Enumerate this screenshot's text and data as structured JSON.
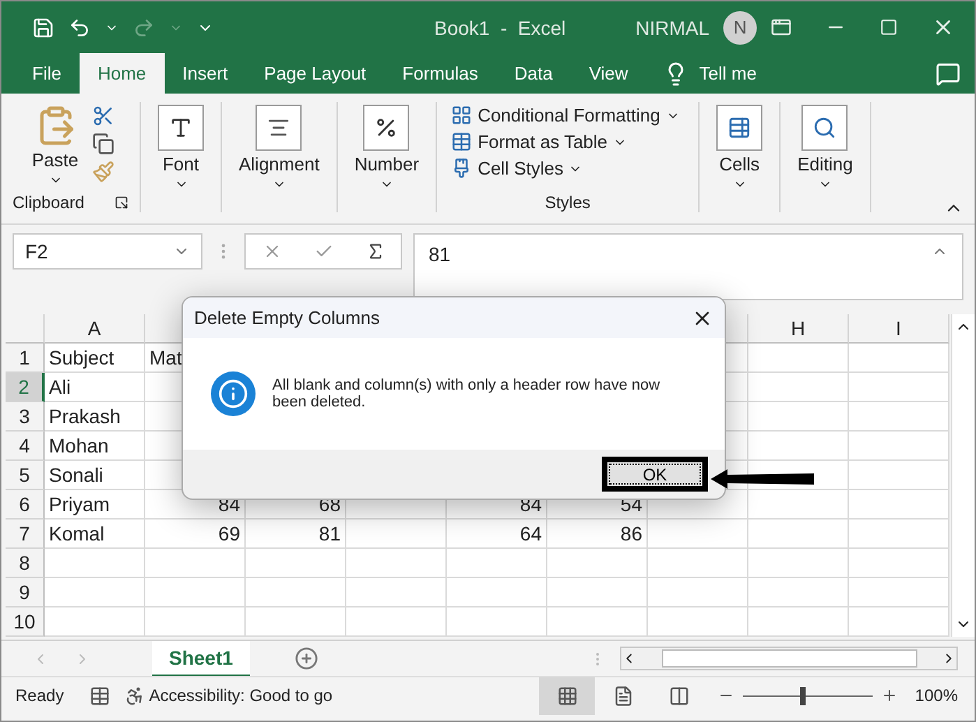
{
  "window": {
    "title": "Book1  -  Excel",
    "user": "NIRMAL",
    "avatar": "N"
  },
  "menu_tabs": [
    {
      "label": "File",
      "selected": false
    },
    {
      "label": "Home",
      "selected": true
    },
    {
      "label": "Insert",
      "selected": false
    },
    {
      "label": "Page Layout",
      "selected": false
    },
    {
      "label": "Formulas",
      "selected": false
    },
    {
      "label": "Data",
      "selected": false
    },
    {
      "label": "View",
      "selected": false
    }
  ],
  "tell_me": "Tell me",
  "ribbon": [
    {
      "kind": "clipboard",
      "button": "Paste",
      "group": "Clipboard"
    },
    {
      "kind": "big",
      "button": "Font"
    },
    {
      "kind": "big",
      "button": "Alignment"
    },
    {
      "kind": "big",
      "button": "Number"
    },
    {
      "kind": "styles",
      "items": [
        "Conditional Formatting",
        "Format as Table",
        "Cell Styles"
      ],
      "group": "Styles"
    },
    {
      "kind": "big",
      "button": "Cells"
    },
    {
      "kind": "big",
      "button": "Editing"
    }
  ],
  "formula_bar": {
    "name_box": "F2",
    "value": "81"
  },
  "sheet": {
    "columns": [
      "A",
      null,
      null,
      null,
      null,
      null,
      null,
      "H",
      "I"
    ],
    "rows": [
      {
        "number": "1",
        "selected": false,
        "cells": [
          "Subject",
          "Mat",
          null,
          null,
          null,
          null,
          null,
          null,
          null
        ]
      },
      {
        "number": "2",
        "selected": true,
        "cells": [
          "Ali",
          null,
          null,
          null,
          null,
          null,
          null,
          null,
          null
        ]
      },
      {
        "number": "3",
        "selected": false,
        "cells": [
          "Prakash",
          null,
          null,
          null,
          null,
          null,
          null,
          null,
          null
        ]
      },
      {
        "number": "4",
        "selected": false,
        "cells": [
          "Mohan",
          null,
          null,
          null,
          null,
          null,
          null,
          null,
          null
        ]
      },
      {
        "number": "5",
        "selected": false,
        "cells": [
          "Sonali",
          null,
          null,
          null,
          null,
          null,
          null,
          null,
          null
        ]
      },
      {
        "number": "6",
        "selected": false,
        "cells": [
          "Priyam",
          "84",
          "68",
          null,
          "84",
          "54",
          null,
          null,
          null
        ]
      },
      {
        "number": "7",
        "selected": false,
        "cells": [
          "Komal",
          "69",
          "81",
          null,
          "64",
          "86",
          null,
          null,
          null
        ]
      },
      {
        "number": "8",
        "selected": false,
        "cells": [
          null,
          null,
          null,
          null,
          null,
          null,
          null,
          null,
          null
        ]
      },
      {
        "number": "9",
        "selected": false,
        "cells": [
          null,
          null,
          null,
          null,
          null,
          null,
          null,
          null,
          null
        ]
      },
      {
        "number": "10",
        "selected": false,
        "cells": [
          null,
          null,
          null,
          null,
          null,
          null,
          null,
          null,
          null
        ]
      }
    ]
  },
  "sheet_tabs": [
    {
      "label": "Sheet1",
      "selected": true
    }
  ],
  "status_bar": {
    "mode": "Ready",
    "accessibility": "Accessibility: Good to go",
    "views": [
      {
        "kind": "normal",
        "selected": true
      },
      {
        "kind": "page-layout",
        "selected": false
      },
      {
        "kind": "page-break",
        "selected": false
      }
    ],
    "zoom_slider": {
      "level": 0.46
    },
    "zoom": "100%"
  },
  "dialog": {
    "title": "Delete Empty Columns",
    "message": "All blank and column(s) with only a header row have now been deleted.",
    "button": "OK",
    "highlighted": true
  }
}
